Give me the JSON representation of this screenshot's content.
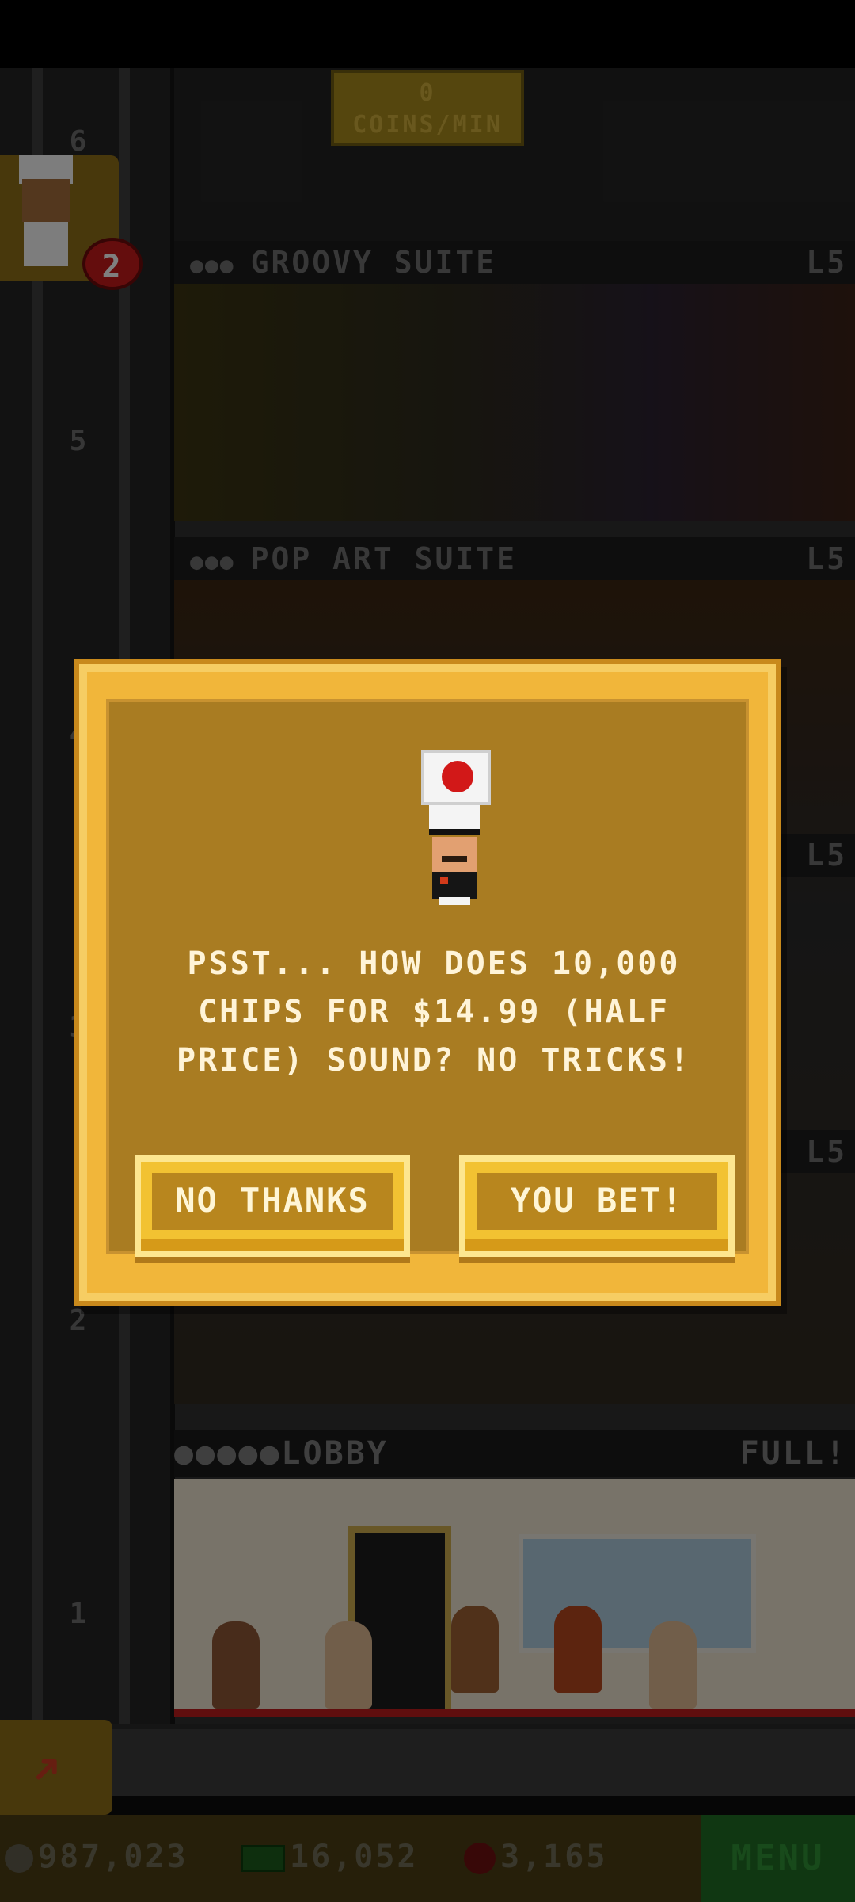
{
  "hud": {
    "coins_per_min_value": "0",
    "coins_per_min_label": "COINS/MIN",
    "chef_badge_count": "2"
  },
  "shaft": {
    "floor_numbers": [
      "6",
      "5",
      "4",
      "3",
      "2",
      "1"
    ]
  },
  "floors": [
    {
      "name": "GROOVY SUITE",
      "level": "L5"
    },
    {
      "name": "POP ART SUITE",
      "level": "L5"
    },
    {
      "name": "LOBBY",
      "level": "FULL!"
    }
  ],
  "side_levels": [
    "L5",
    "L5"
  ],
  "dialog": {
    "message": "PSST... HOW DOES 10,000 CHIPS FOR $14.99 (HALF PRICE) SOUND? NO TRICKS!",
    "decline_label": "NO THANKS",
    "accept_label": "YOU BET!"
  },
  "bottom_bar": {
    "coins": "987,023",
    "bux": "16,052",
    "chips": "3,165",
    "menu_label": "MENU"
  },
  "colors": {
    "dialog_gold": "#f1b63a",
    "dialog_inner": "#a97c22",
    "menu_green": "#1f6a24",
    "badge_red": "#c01a1a"
  }
}
